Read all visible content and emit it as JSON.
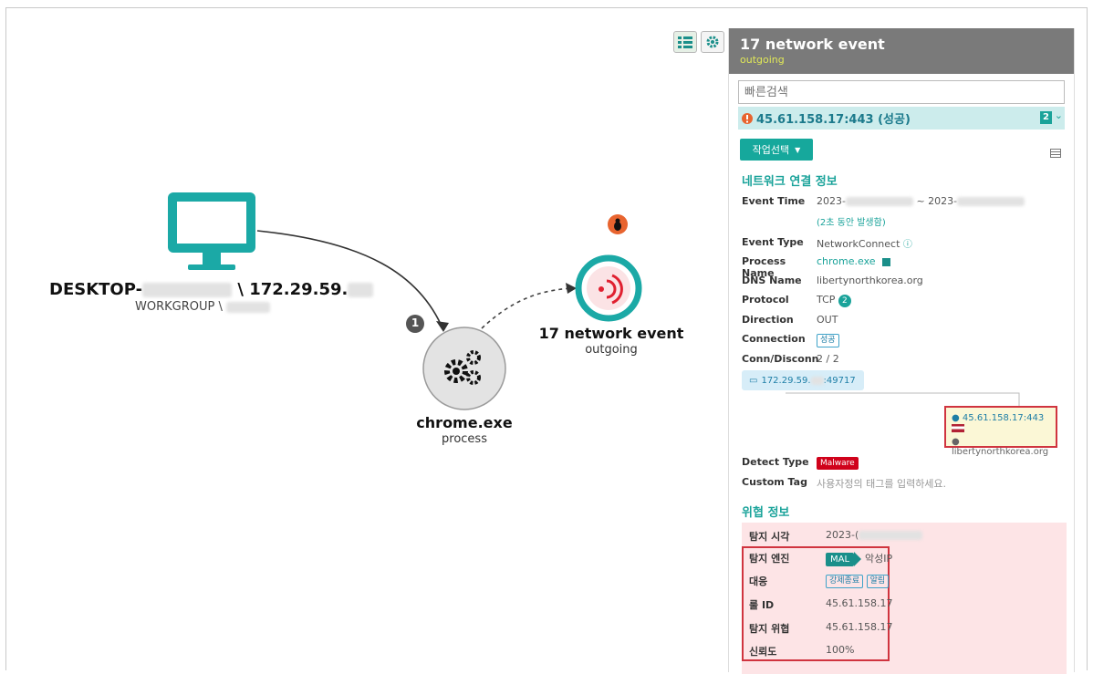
{
  "graph": {
    "host": {
      "name_prefix": "DESKTOP-",
      "name_suffix": "\\ 172.29.59.",
      "workgroup": "WORKGROUP \\"
    },
    "edge_badge": "1",
    "process": {
      "name": "chrome.exe",
      "type": "process"
    },
    "network": {
      "title": "17 network event",
      "subtitle": "outgoing"
    }
  },
  "panel": {
    "title": "17 network event",
    "subtitle": "outgoing",
    "search_placeholder": "빠른검색",
    "selected_item": "45.61.158.17:443 (성공)",
    "selected_count": "2",
    "action_button": "작업선택",
    "network_section": {
      "title": "네트워크 연결 정보",
      "event_time_label": "Event Time",
      "event_time_prefix": "2023-",
      "event_time_sep": "~ 2023-",
      "event_time_note": "(2초 동안 발생함)",
      "event_type_label": "Event Type",
      "event_type_value": "NetworkConnect",
      "process_name_label": "Process Name",
      "process_name_value": "chrome.exe",
      "dns_name_label": "DNS Name",
      "dns_name_value": "libertynorthkorea.org",
      "protocol_label": "Protocol",
      "protocol_value": "TCP",
      "protocol_badge": "2",
      "direction_label": "Direction",
      "direction_value": "OUT",
      "connection_label": "Connection",
      "connection_value": "성공",
      "conn_disconn_label": "Conn/Disconn",
      "conn_disconn_value": "2 / 2",
      "source_ip_prefix": "172.29.59.",
      "source_port": ":49717",
      "dest_ip": "45.61.158.17:443",
      "dest_domain": "libertynorthkorea.org",
      "detect_type_label": "Detect Type",
      "detect_type_value": "Malware",
      "custom_tag_label": "Custom Tag",
      "custom_tag_placeholder": "사용자정의 태그를 입력하세요."
    },
    "threat_section": {
      "title": "위협 정보",
      "detect_time_label": "탐지 시각",
      "detect_time_value": "2023-(",
      "engine_label": "탐지 엔진",
      "engine_chip": "MAL",
      "engine_value": "악성IP",
      "response_label": "대응",
      "response_tags": [
        "강제종료",
        "알림"
      ],
      "rule_id_label": "룰 ID",
      "rule_id_value": "45.61.158.17",
      "threat_label": "탐지 위협",
      "threat_value": "45.61.158.17",
      "confidence_label": "신뢰도",
      "confidence_value": "100%"
    }
  },
  "colors": {
    "teal": "#1aa39a",
    "header_gray": "#7a7a7a",
    "malware_red": "#d0021b",
    "highlight_red": "#d0343f",
    "threat_bg": "#fde4e6"
  }
}
